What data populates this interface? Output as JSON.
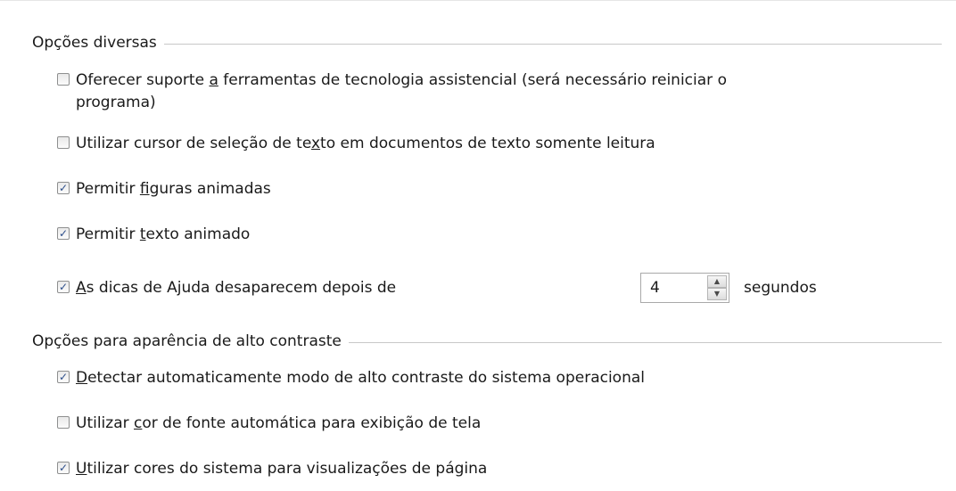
{
  "misc_options": {
    "title": "Opções diversas",
    "items": [
      {
        "pre": "Oferecer suporte ",
        "key": "a",
        "post": " ferramentas de tecnologia assistencial (será necessário reiniciar o",
        "line2": "programa)",
        "checked": "false"
      },
      {
        "pre": "Utilizar cursor de seleção de te",
        "key": "x",
        "post": "to em documentos de texto somente leitura",
        "checked": "false"
      },
      {
        "pre": "Permitir ",
        "key": "f",
        "post": "iguras animadas",
        "checked": "true"
      },
      {
        "pre": "Permitir ",
        "key": "t",
        "post": "exto animado",
        "checked": "true"
      },
      {
        "pre": "",
        "key": "A",
        "post": "s dicas de Ajuda desaparecem depois de",
        "checked": "true"
      }
    ],
    "tooltip_timeout": {
      "value": "4",
      "unit": "segundos"
    }
  },
  "contrast_options": {
    "title": "Opções para aparência de alto contraste",
    "items": [
      {
        "pre": "",
        "key": "D",
        "post": "etectar automaticamente modo de alto contraste do sistema operacional",
        "checked": "true"
      },
      {
        "pre": "Utilizar ",
        "key": "c",
        "post": "or de fonte automática para exibição de tela",
        "checked": "false"
      },
      {
        "pre": "",
        "key": "U",
        "post": "tilizar cores do sistema para visualizações de página",
        "checked": "true"
      }
    ]
  },
  "check_glyph": "✓"
}
